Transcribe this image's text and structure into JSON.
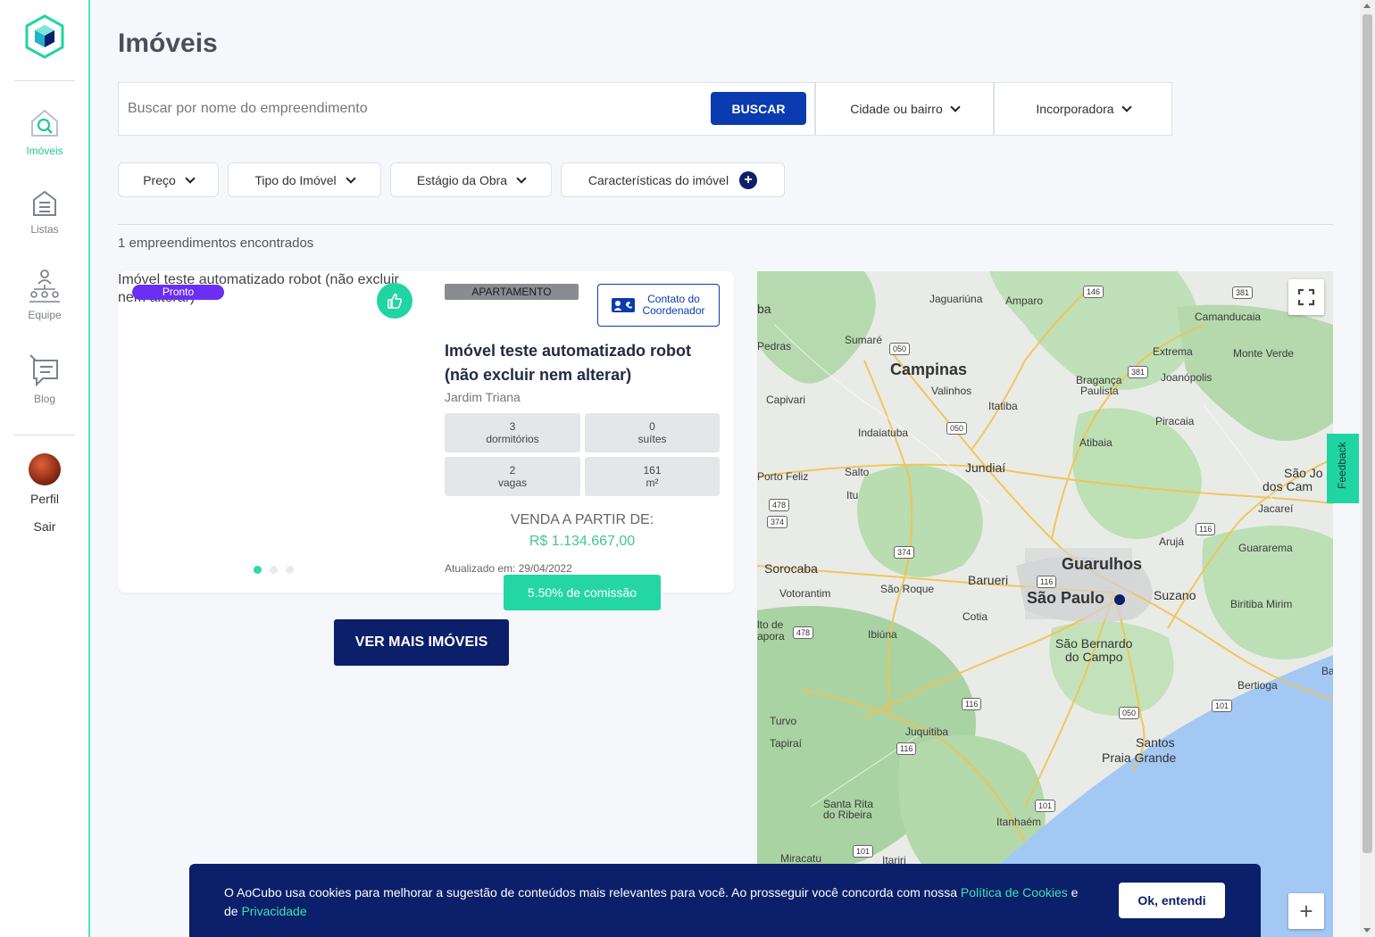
{
  "sidebar": {
    "logo_icon": "cube-logo-icon",
    "items": [
      {
        "label": "Imóveis",
        "icon": "house-search-icon",
        "active": true
      },
      {
        "label": "Listas",
        "icon": "list-house-icon",
        "active": false
      },
      {
        "label": "Equipe",
        "icon": "team-icon",
        "active": false
      },
      {
        "label": "Blog",
        "icon": "chat-bubble-icon",
        "active": false
      }
    ],
    "profile_label": "Perfil",
    "logout_label": "Sair"
  },
  "page": {
    "title": "Imóveis"
  },
  "search": {
    "placeholder": "Buscar por nome do empreendimento",
    "value": "",
    "button_label": "BUSCAR",
    "city_dropdown": "Cidade ou bairro",
    "developer_dropdown": "Incorporadora"
  },
  "filters": {
    "price": "Preço",
    "type": "Tipo do Imóvel",
    "stage": "Estágio da Obra",
    "features": "Características do imóvel"
  },
  "results_text": "1 empreendimentos encontrados",
  "listing": {
    "image_alt": "Imóvel teste automatizado robot (não excluir nem alterar)",
    "status_badge": "Pronto",
    "type_badge": "APARTAMENTO",
    "contact_label_1": "Contato do",
    "contact_label_2": "Coordenador",
    "title": "Imóvel teste automatizado robot (não excluir nem alterar)",
    "neighborhood": "Jardim Triana",
    "features": [
      {
        "value": "3",
        "unit": "dormitórios"
      },
      {
        "value": "0",
        "unit": "suítes"
      },
      {
        "value": "2",
        "unit": "vagas"
      },
      {
        "value": "161",
        "unit": "m²"
      }
    ],
    "price_label": "VENDA A PARTIR DE:",
    "price": "R$ 1.134.667,00",
    "updated": "Atualizado em: 29/04/2022",
    "commission": "5.50% de comissão",
    "carousel_index": 1,
    "carousel_total": 3
  },
  "more_button": "VER MAIS IMÓVEIS",
  "feedback_label": "Feedback",
  "map": {
    "labels": [
      {
        "text": "Jaguariúna"
      },
      {
        "text": "Amparo"
      },
      {
        "text": "Camanducaia"
      },
      {
        "text": "ba"
      },
      {
        "text": "Pedras"
      },
      {
        "text": "Sumaré"
      },
      {
        "text": "Campinas"
      },
      {
        "text": "Valinhos"
      },
      {
        "text": "Extrema"
      },
      {
        "text": "Monte Verde"
      },
      {
        "text": "Bragança"
      },
      {
        "text": "Paulista"
      },
      {
        "text": "Joanópolis"
      },
      {
        "text": "Capivari"
      },
      {
        "text": "Itatiba"
      },
      {
        "text": "Indaiatuba"
      },
      {
        "text": "Piracaia"
      },
      {
        "text": "Atibaia"
      },
      {
        "text": "Porto Feliz"
      },
      {
        "text": "Salto"
      },
      {
        "text": "Jundiaí"
      },
      {
        "text": "São Jo"
      },
      {
        "text": "dos Cam"
      },
      {
        "text": "Itu"
      },
      {
        "text": "Jacareí"
      },
      {
        "text": "Arujá"
      },
      {
        "text": "Guararema"
      },
      {
        "text": "Sorocaba"
      },
      {
        "text": "Guarulhos"
      },
      {
        "text": "Barueri"
      },
      {
        "text": "Votorantim"
      },
      {
        "text": "São Roque"
      },
      {
        "text": "São Paulo"
      },
      {
        "text": "Suzano"
      },
      {
        "text": "Biritiba Mirim"
      },
      {
        "text": "Cotia"
      },
      {
        "text": "lto de"
      },
      {
        "text": "apora"
      },
      {
        "text": "Ibiúna"
      },
      {
        "text": "São Bernardo"
      },
      {
        "text": "do Campo"
      },
      {
        "text": "Ba"
      },
      {
        "text": "Bertioga"
      },
      {
        "text": "Turvo"
      },
      {
        "text": "Juquitiba"
      },
      {
        "text": "Tapiraí"
      },
      {
        "text": "Santos"
      },
      {
        "text": "Praia Grande"
      },
      {
        "text": "Santa Rita"
      },
      {
        "text": "do Ribeira"
      },
      {
        "text": "Itanhaém"
      },
      {
        "text": "Miracatu"
      },
      {
        "text": "Itariri"
      }
    ],
    "shields": [
      "146",
      "381",
      "050",
      "381",
      "050",
      "478",
      "374",
      "374",
      "116",
      "116",
      "478",
      "116",
      "050",
      "101",
      "116",
      "101",
      "101"
    ],
    "fullscreen_icon": "fullscreen-icon",
    "zoom_in_label": "+"
  },
  "cookie": {
    "text_before": "O AoCubo usa cookies para melhorar a sugestão de conteúdos mais relevantes para você. Ao prosseguir você concorda com nossa ",
    "policy_link": "Política de Cookies",
    "text_mid": " e de ",
    "privacy_link": "Privacidade",
    "ok_label": "Ok, entendi"
  },
  "colors": {
    "accent": "#20d5a3",
    "primary": "#0b3bb0",
    "navy": "#0b1f6a",
    "badge_purple": "#6a2ff2",
    "price_green": "#3fc78f"
  }
}
